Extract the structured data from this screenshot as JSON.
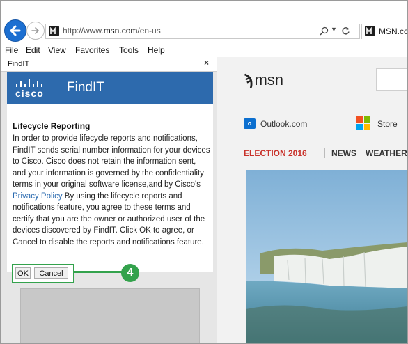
{
  "browser": {
    "url_prefix": "http://www.",
    "url_domain": "msn.com",
    "url_path": "/en-us",
    "tab_title": "MSN.com"
  },
  "menu": [
    "File",
    "Edit",
    "View",
    "Favorites",
    "Tools",
    "Help"
  ],
  "sidebar": {
    "title": "FindIT",
    "close": "×",
    "brand_company": "cisco",
    "brand_product": "FindIT",
    "heading": "Lifecycle Reporting",
    "body_before_link": "In order to provide lifecycle reports and notifications, FindIT sends serial number information for your devices to Cisco. Cisco does not retain the information sent, and your information is governed by the confidentiality terms in your original software license,and by Cisco's ",
    "link_text": "Privacy Policy",
    "body_after_link": " By using the lifecycle reports and notifications feature, you agree to these terms and certify that you are the owner or authorized user of the devices discovered by FindIT. Click OK to agree, or Cancel to disable the reports and notifications feature.",
    "ok_label": "OK",
    "cancel_label": "Cancel"
  },
  "callout_number": "4",
  "msn": {
    "logo_text": "msn",
    "outlook_icon_text": "o",
    "outlook_label": "Outlook.com",
    "store_label": "Store",
    "nav": [
      "ELECTION 2016",
      "NEWS",
      "WEATHER"
    ]
  },
  "colors": {
    "accent_green": "#33a24c",
    "cisco_blue": "#2d6aad",
    "election_red": "#c8312a",
    "link_blue": "#2b6bb0"
  }
}
